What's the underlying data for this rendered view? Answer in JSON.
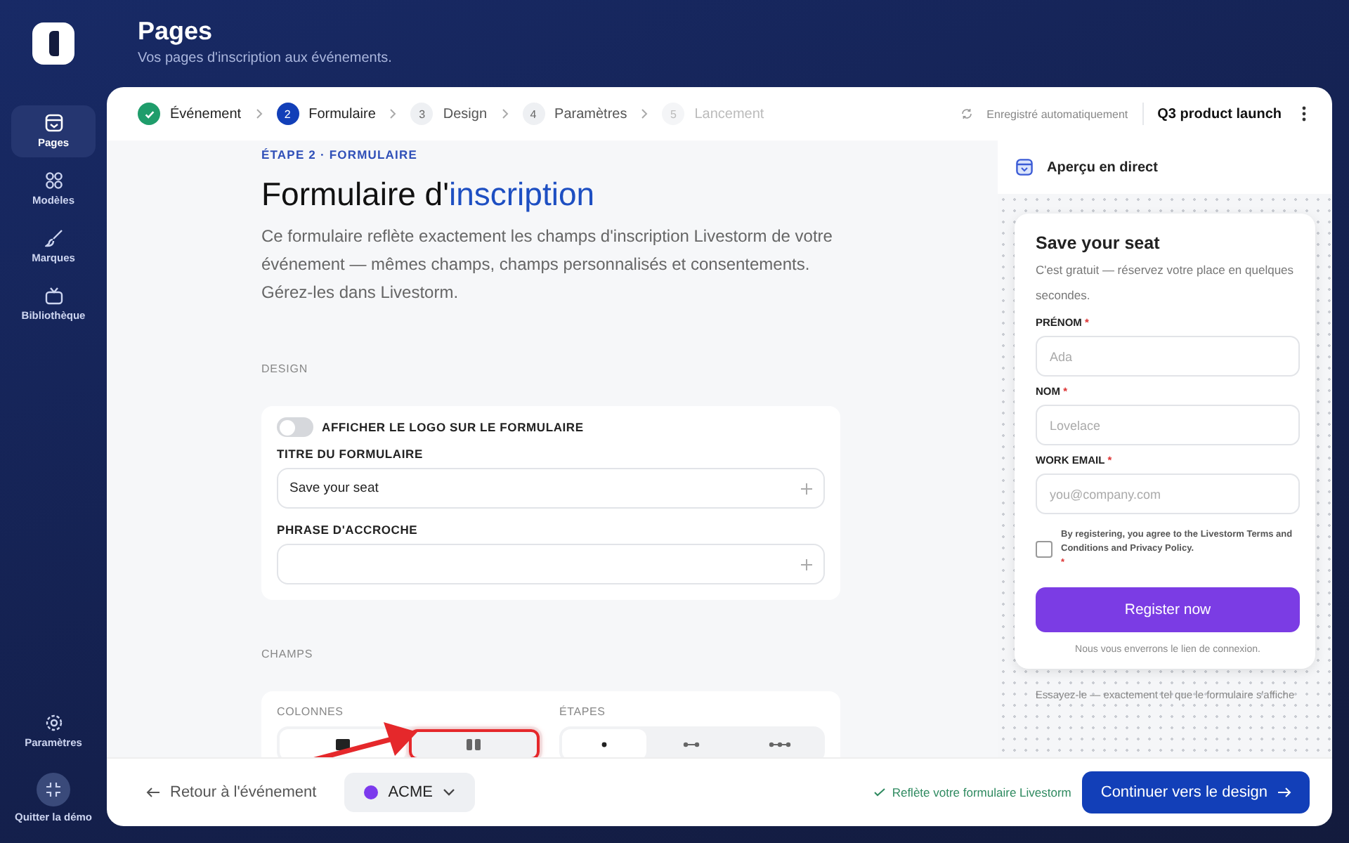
{
  "header": {
    "title": "Pages",
    "subtitle": "Vos pages d'inscription aux événements."
  },
  "sidebar": {
    "items": [
      {
        "kind": "pages",
        "label": "Pages",
        "selected": true
      },
      {
        "kind": "templates",
        "label": "Modèles",
        "selected": false
      },
      {
        "kind": "brands",
        "label": "Marques",
        "selected": false
      },
      {
        "kind": "library",
        "label": "Bibliothèque",
        "selected": false
      }
    ],
    "bottom_items": [
      {
        "kind": "settings",
        "label": "Paramètres"
      },
      {
        "kind": "exit",
        "label": "Quitter la démo"
      }
    ]
  },
  "stepper": {
    "steps": [
      {
        "label": "Événement",
        "completed": true,
        "selected": false,
        "disabled": false
      },
      {
        "number": "2",
        "label": "Formulaire",
        "completed": false,
        "selected": true,
        "disabled": false
      },
      {
        "number": "3",
        "label": "Design",
        "completed": false,
        "selected": false,
        "disabled": false
      },
      {
        "number": "4",
        "label": "Paramètres",
        "completed": false,
        "selected": false,
        "disabled": false
      },
      {
        "number": "5",
        "label": "Lancement",
        "completed": false,
        "selected": false,
        "disabled": true
      }
    ],
    "autosave": "Enregistré automatiquement",
    "event_name": "Q3 product launch"
  },
  "editor": {
    "eyebrow": "ÉTAPE 2 · FORMULAIRE",
    "title_start": "Formulaire d'",
    "title_highlight": "inscription",
    "description": "Ce formulaire reflète exactement les champs d'inscription Livestorm de votre événement — mêmes champs, champs personnalisés et consentements. Gérez-les dans Livestorm.",
    "design": {
      "label": "DESIGN",
      "logo_toggle": {
        "label": "AFFICHER LE LOGO SUR LE FORMULAIRE",
        "on": false
      },
      "fields": [
        {
          "label": "TITRE DU FORMULAIRE",
          "value": "Save your seat"
        },
        {
          "label": "PHRASE D'ACCROCHE"
        }
      ]
    },
    "fields_section": {
      "label": "CHAMPS",
      "columns": {
        "label": "COLONNES",
        "options": [
          {
            "kind": "one",
            "selected": true,
            "highlighted": false
          },
          {
            "kind": "two",
            "selected": false,
            "highlighted": true
          }
        ]
      },
      "steps": {
        "label": "ÉTAPES",
        "options": [
          {
            "kind": "one",
            "selected": true,
            "highlighted": false
          },
          {
            "kind": "two",
            "selected": false,
            "highlighted": false
          },
          {
            "kind": "three",
            "selected": false,
            "highlighted": false
          }
        ]
      }
    }
  },
  "preview": {
    "title": "Aperçu en direct",
    "card": {
      "title": "Save your seat",
      "subtitle": "C'est gratuit — réservez votre place en quelques secondes.",
      "fields": [
        {
          "label": "PRÉNOM",
          "required_mark": "*",
          "placeholder": "Ada"
        },
        {
          "label": "NOM",
          "required_mark": "*",
          "placeholder": "Lovelace"
        },
        {
          "label": "WORK EMAIL",
          "required_mark": "*",
          "placeholder": "you@company.com"
        }
      ],
      "consent": {
        "text": "By registering, you agree to the Livestorm Terms and Conditions and Privacy Policy.",
        "required_mark": "*",
        "checked": false
      },
      "button": "Register now",
      "note": "Nous vous enverrons le lien de connexion."
    },
    "caption": "Essayez-le — exactement tel que le formulaire s'affiche"
  },
  "footer": {
    "back": "Retour à l'événement",
    "brand": {
      "name": "ACME",
      "color": "#7c3aed"
    },
    "status": "Reflète votre formulaire Livestorm",
    "continue": "Continuer vers le design"
  }
}
